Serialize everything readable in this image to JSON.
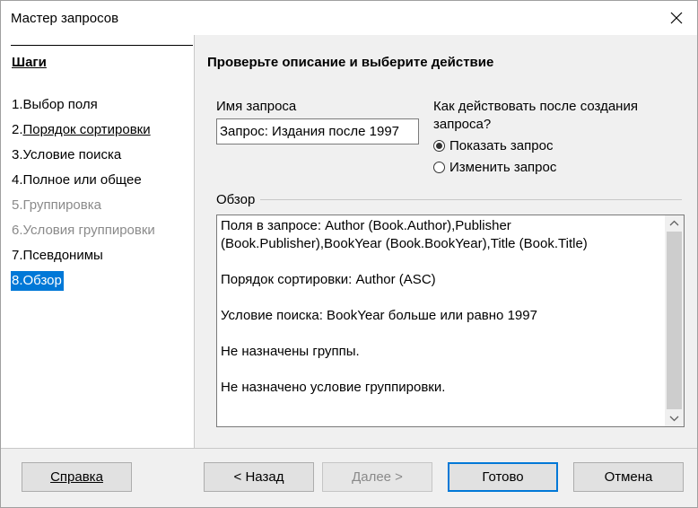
{
  "window": {
    "title": "Мастер запросов",
    "close_icon": "close-icon"
  },
  "steps": {
    "header": "Шаги",
    "items": [
      {
        "num": "1.",
        "label": "Выбор поля",
        "state": "normal",
        "underline_label": false
      },
      {
        "num": "2.",
        "label": "Порядок сортировки",
        "state": "normal",
        "underline_label": true
      },
      {
        "num": "3.",
        "label": "Условие поиска",
        "state": "normal",
        "underline_label": false
      },
      {
        "num": "4.",
        "label": "Полное или общее",
        "state": "normal",
        "underline_label": false
      },
      {
        "num": "5.",
        "label": "Группировка",
        "state": "disabled",
        "underline_label": false
      },
      {
        "num": "6.",
        "label": "Условия группировки",
        "state": "disabled",
        "underline_label": false
      },
      {
        "num": "7.",
        "label": "Псевдонимы",
        "state": "normal",
        "underline_label": false
      },
      {
        "num": "8.",
        "label": "Обзор",
        "state": "active",
        "underline_label": false
      }
    ]
  },
  "main": {
    "section_title": "Проверьте описание и выберите действие",
    "query_name_label": "Имя запроса",
    "query_name_value": "Запрос: Издания после 1997",
    "after_label": "Как действовать после создания запроса?",
    "radios": [
      {
        "label": "Показать запрос",
        "checked": true
      },
      {
        "label": "Изменить запрос",
        "checked": false
      }
    ],
    "overview_label": "Обзор",
    "overview_lines": [
      "Поля в запросе: Author (Book.Author),Publisher (Book.Publisher),BookYear (Book.BookYear),Title (Book.Title)",
      "Порядок сортировки: Author (ASC)",
      "Условие поиска: BookYear больше или равно 1997",
      "Не назначены группы.",
      "Не назначено условие группировки."
    ]
  },
  "buttons": {
    "help": "Справка",
    "back": "< Назад",
    "next": "Далее >",
    "finish": "Готово",
    "cancel": "Отмена"
  },
  "colors": {
    "accent": "#0078d7",
    "disabled_text": "#8a8a8a"
  }
}
